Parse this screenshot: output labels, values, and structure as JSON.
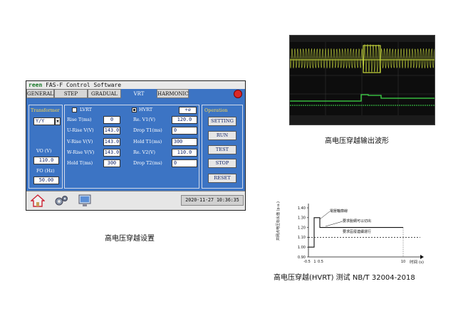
{
  "software": {
    "brand": "reen",
    "title": "FAS-F Control Software",
    "tabs": [
      {
        "label": "GENERAL",
        "active": false
      },
      {
        "label": "STEP",
        "active": false
      },
      {
        "label": "GRADUAL",
        "active": false
      },
      {
        "label": "VRT",
        "active": true
      },
      {
        "label": "HARMONIC",
        "active": false
      }
    ],
    "transformer": {
      "label": "Transformer",
      "value": "Y/Y",
      "vo_label": "VO (V)",
      "vo_value": "110.0",
      "fo_label": "FO (Hz)",
      "fo_value": "50.00"
    },
    "lvrt": {
      "label": "LVRT",
      "checked": false
    },
    "hvrt": {
      "label": "HVRT",
      "checked": true
    },
    "unit_badge": "+ø",
    "params_left": [
      {
        "label": "Rise T(ms)",
        "value": "0"
      },
      {
        "label": "U-Rise V(V)",
        "value": "143.0"
      },
      {
        "label": "V-Rise V(V)",
        "value": "143.0"
      },
      {
        "label": "W-Rise V(V)",
        "value": "143.0"
      },
      {
        "label": "Hold T(ms)",
        "value": "300"
      }
    ],
    "params_right": [
      {
        "label": "Re. V1(V)",
        "value": "120.0"
      },
      {
        "label": "Drop T1(ms)",
        "value": "0"
      },
      {
        "label": "Hold T1(ms)",
        "value": "300"
      },
      {
        "label": "Re. V2(V)",
        "value": "110.0"
      },
      {
        "label": "Drop T2(ms)",
        "value": "0"
      }
    ],
    "operation": {
      "label": "Operation",
      "buttons": [
        "SETTING",
        "RUN",
        "TEST",
        "STOP",
        "RESET"
      ]
    },
    "datetime": "2020-11-27 10:36:35",
    "icons": [
      "home-icon",
      "settings-icon",
      "computer-icon"
    ],
    "colors": {
      "panel": "#3c74c4",
      "accent_yellow": "#ffd84a",
      "power": "#d92828"
    }
  },
  "captions": {
    "settings": "高电压穿越设置",
    "waveform": "高电压穿越输出波形",
    "standard": "高电压穿越(HVRT) 测试 NB/T 32004-2018"
  },
  "chart_data": {
    "type": "line",
    "ylabel": "并网点电压标幺值 (p.u.)",
    "xlabel": "时间 (s)",
    "x_ticks": [
      "-0.5",
      "1",
      "0.5",
      "10"
    ],
    "y_ticks": [
      "1.40",
      "1.30",
      "1.20",
      "1.10",
      "1.00",
      "0.90"
    ],
    "ylim": [
      0.9,
      1.4
    ],
    "annotations": [
      "電壓輪廓線",
      "要求脫網可以切出",
      "要求區廢連續運行"
    ],
    "series": [
      {
        "x": [
          -0.5,
          0,
          0,
          0.5,
          0.5,
          10
        ],
        "y": [
          1.0,
          1.0,
          1.3,
          1.3,
          1.2,
          1.2
        ]
      }
    ],
    "threshold": 1.1
  }
}
